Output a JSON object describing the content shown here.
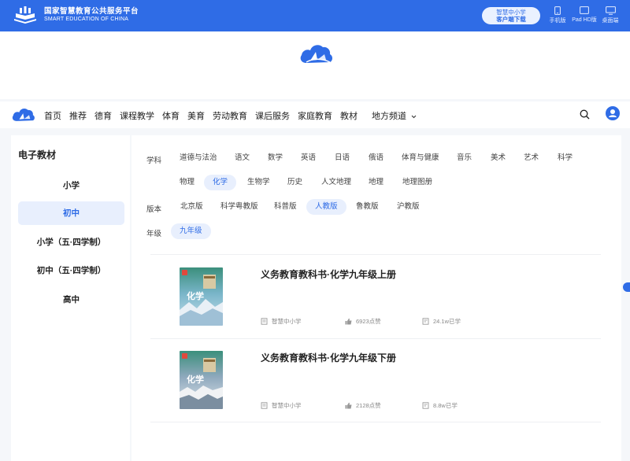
{
  "header": {
    "brand_cn": "国家智慧教育公共服务平台",
    "brand_en": "SMART EDUCATION OF CHINA",
    "client_line1": "智慧中小学",
    "client_line2": "客户端下载",
    "devices": [
      {
        "label": "手机版",
        "icon": "phone-icon"
      },
      {
        "label": "Pad HD版",
        "icon": "tablet-icon"
      },
      {
        "label": "桌面端",
        "icon": "desktop-icon"
      }
    ]
  },
  "nav": {
    "items": [
      "首页",
      "推荐",
      "德育",
      "课程教学",
      "体育",
      "美育",
      "劳动教育",
      "课后服务",
      "家庭教育",
      "教材"
    ],
    "regional": "地方频道"
  },
  "sidebar": {
    "title": "电子教材",
    "items": [
      "小学",
      "初中",
      "小学（五·四学制）",
      "初中（五·四学制）",
      "高中"
    ],
    "active": "初中"
  },
  "filters": {
    "subject_label": "学科",
    "subjects_row1": [
      "道德与法治",
      "语文",
      "数学",
      "英语",
      "日语",
      "俄语",
      "体育与健康",
      "音乐",
      "美术",
      "艺术",
      "科学"
    ],
    "subjects_row2": [
      "物理",
      "化学",
      "生物学",
      "历史",
      "人文地理",
      "地理",
      "地理图册"
    ],
    "subject_active": "化学",
    "edition_label": "版本",
    "editions": [
      "北京版",
      "科学粤教版",
      "科普版",
      "人教版",
      "鲁教版",
      "沪教版"
    ],
    "edition_active": "人教版",
    "grade_label": "年级",
    "grades": [
      "九年级"
    ],
    "grade_active": "九年级"
  },
  "books": [
    {
      "title": "义务教育教科书·化学九年级上册",
      "publisher": "智慧中小学",
      "likes": "6923点赞",
      "learners": "24.1w已学"
    },
    {
      "title": "义务教育教科书·化学九年级下册",
      "publisher": "智慧中小学",
      "likes": "2128点赞",
      "learners": "8.8w已学"
    }
  ],
  "colors": {
    "brand": "#2f6ce6",
    "active_bg": "#e8effd"
  }
}
